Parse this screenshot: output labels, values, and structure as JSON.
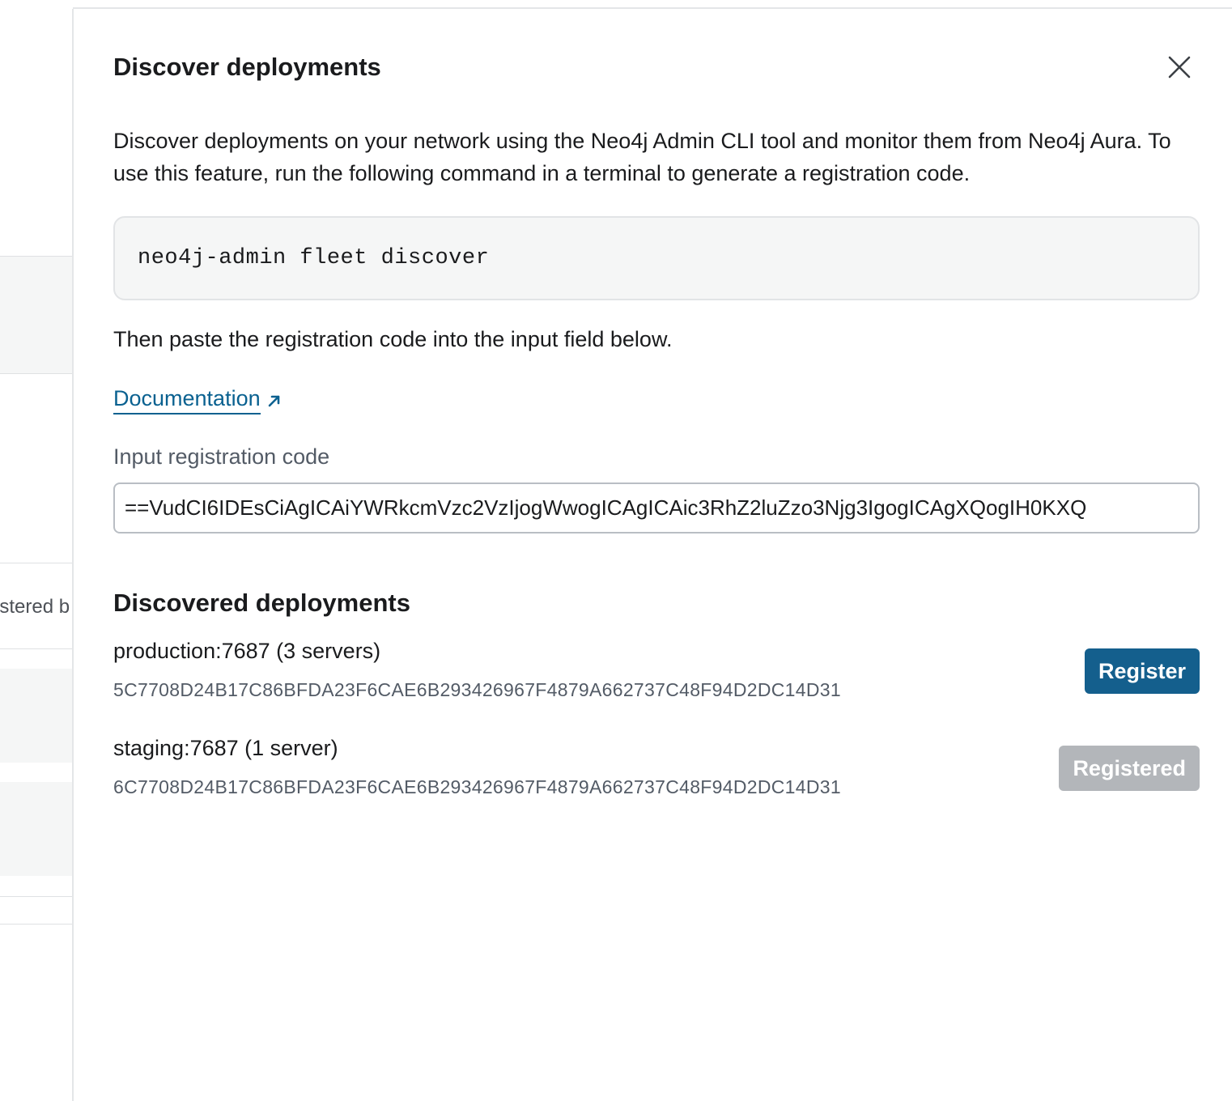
{
  "background": {
    "partial_text": "istered b"
  },
  "dialog": {
    "title": "Discover deployments",
    "close_icon": "close-icon",
    "description": "Discover deployments on your network using the Neo4j Admin CLI tool and monitor them from Neo4j Aura. To use this feature, run the following command in a terminal to generate a registration code.",
    "command": "neo4j-admin fleet discover",
    "paste_instruction": "Then paste the registration code into the input field below.",
    "documentation_link": "Documentation",
    "documentation_icon": "external-link-arrow-icon",
    "input_label": "Input registration code",
    "input_value": "VudCI6IDEsCiAgICAiYWRkcmVzc2VzIjogWwogICAgICAic3RhZ2luZzo3Njg3IgogICAgXQogIH0KXQ==",
    "discovered_title": "Discovered deployments",
    "deployments": [
      {
        "name": "production:7687 (3 servers)",
        "id": "5C7708D24B17C86BFDA23F6CAE6B293426967F4879A662737C48F94D2DC14D31",
        "action": "Register",
        "status": "unregistered"
      },
      {
        "name": "staging:7687 (1 server)",
        "id": "6C7708D24B17C86BFDA23F6CAE6B293426967F4879A662737C48F94D2DC14D31",
        "action": "Registered",
        "status": "registered"
      }
    ]
  },
  "colors": {
    "primary_button": "#145f8d",
    "disabled_button": "#b3b6ba",
    "link": "#0a6190"
  }
}
